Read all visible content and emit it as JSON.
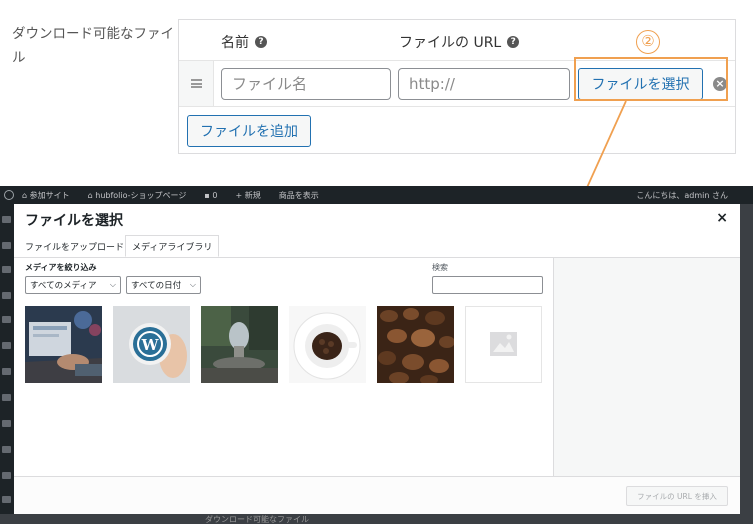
{
  "settings": {
    "downloadable_files_label": "ダウンロード可能なファイル",
    "col_name": "名前",
    "col_file_url": "ファイルの URL",
    "file_name_placeholder": "ファイル名",
    "file_url_placeholder": "http://",
    "choose_file_label": "ファイルを選択",
    "add_file_label": "ファイルを追加",
    "help_icon": "question-circle-icon",
    "remove_icon": "remove-circle-icon",
    "drag_icon": "drag-handle-icon"
  },
  "annotation": {
    "step_number": "②",
    "color": "#f0a050"
  },
  "admin_bar": {
    "site_name": "参加サイト",
    "shop_page": "hubfolio-ショップページ",
    "comments_count": "0",
    "new_label": "新規",
    "view_product": "商品を表示",
    "greeting": "こんにちは、admin さん"
  },
  "media_modal": {
    "title": "ファイルを選択",
    "close_label": "×",
    "tabs": [
      {
        "label": "ファイルをアップロード",
        "active": false
      },
      {
        "label": "メディアライブラリ",
        "active": true
      }
    ],
    "filter_label": "メディアを絞り込み",
    "filter_type": "すべてのメディア",
    "filter_date": "すべての日付",
    "search_label": "検索",
    "insert_button": "ファイルの URL を挿入",
    "thumbnails": [
      "laptop-typing-photo",
      "wordpress-logo-badge-photo",
      "garden-fountain-photo",
      "coffee-cup-photo",
      "coffee-beans-photo",
      "placeholder-image"
    ]
  },
  "backdrop_footer_text": "ダウンロード可能なファイル",
  "colors": {
    "accent": "#2271b1",
    "admin_bar": "#1d2327",
    "highlight": "#f0a050"
  }
}
